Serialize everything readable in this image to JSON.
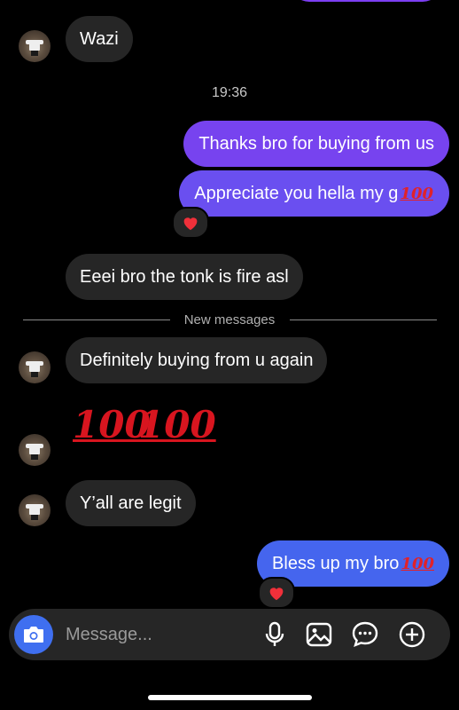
{
  "colors": {
    "outgoing_purple": "#7744ee",
    "outgoing_blue": "#4a63f0",
    "incoming": "#262626",
    "background": "#000000",
    "camera_button": "#3f6ff0"
  },
  "conversation": {
    "messages": [
      {
        "side": "in",
        "text": "Wazi"
      },
      {
        "side": "out",
        "text": "Thanks bro for buying from us"
      },
      {
        "side": "out",
        "text": "Appreciate you hella my g",
        "emoji": "100",
        "reaction": "heart"
      },
      {
        "side": "in",
        "text": "Eeei bro the tonk is fire asl"
      },
      {
        "side": "in",
        "text": "Definitely buying from u again"
      },
      {
        "side": "in",
        "text": "100",
        "text2": "100",
        "kind": "emoji-only"
      },
      {
        "side": "in",
        "text": "Y’all are legit"
      },
      {
        "side": "out",
        "text": "Bless up my bro",
        "emoji": "100",
        "reaction": "heart"
      }
    ],
    "timestamp": "19:36",
    "new_messages_label": "New messages"
  },
  "composer": {
    "placeholder": "Message...",
    "icons": [
      "camera-icon",
      "microphone-icon",
      "gallery-icon",
      "sticker-icon",
      "add-icon"
    ]
  }
}
